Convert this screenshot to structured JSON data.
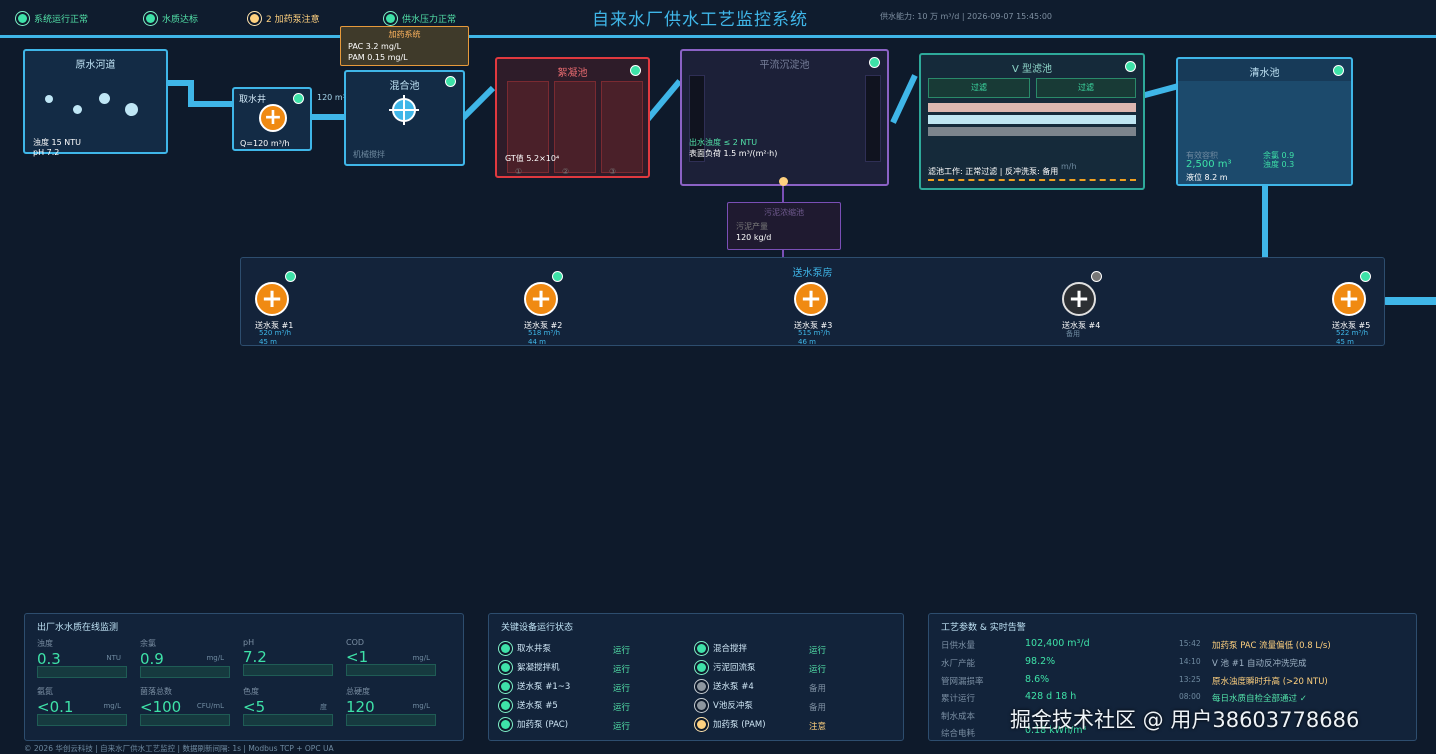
{
  "header": {
    "title": "自来水厂供水工艺监控系统",
    "capacity": "供水能力: 10 万 m³/d  |  2026-09-07 15:45:00",
    "statuses": [
      {
        "label": "系统运行正常",
        "color": "#52e0a8"
      },
      {
        "label": "水质达标",
        "color": "#52e0a8"
      },
      {
        "label": "2 加药泵注意",
        "color": "#ffd17f"
      },
      {
        "label": "供水压力正常",
        "color": "#52e0a8"
      }
    ]
  },
  "colors": {
    "accent": "#3fb6e8",
    "ok": "#3ee2a8",
    "warn": "#ffd17f",
    "pump": "#f08a12"
  },
  "process": {
    "river": {
      "title": "原水河道",
      "turbidity": "浊度 15 NTU",
      "ph": "pH 7.2"
    },
    "intake": {
      "title": "取水井",
      "flow": "Q=120 m³/h",
      "pipe_label": "120 m³"
    },
    "dosing": {
      "title": "加药系统",
      "pac": "PAC  3.2 mg/L",
      "pam": "PAM  0.15 mg/L"
    },
    "mixing": {
      "title": "混合池",
      "sub": "机械搅拌"
    },
    "flocc": {
      "title": "絮凝池",
      "gt": "GT值 5.2×10⁴",
      "cells": [
        "①",
        "②",
        "③"
      ]
    },
    "sedim": {
      "title": "平流沉淀池",
      "out": "出水浊度 ≤ 2 NTU",
      "load": "表面负荷 1.5 m³/(m²·h)"
    },
    "sludge": {
      "title": "污泥浓缩池",
      "label": "污泥产量",
      "value": "120 kg/d"
    },
    "vfilter": {
      "title": "V 型滤池",
      "left": "过滤",
      "right": "过滤",
      "rate": "m/h",
      "status": "滤池工作: 正常过滤  |  反冲洗泵: 备用"
    },
    "clear": {
      "title": "清水池",
      "cap_label": "有效容积",
      "cap": "2,500 m³",
      "level": "液位 8.2 m",
      "chlorine": "余氯 0.9",
      "turb": "浊度 0.3"
    },
    "pumphouse": {
      "title": "送水泵房",
      "pumps": [
        {
          "name": "送水泵 #1",
          "flow": "520 m³/h",
          "head": "45 m",
          "on": true
        },
        {
          "name": "送水泵 #2",
          "flow": "518 m³/h",
          "head": "44 m",
          "on": true
        },
        {
          "name": "送水泵 #3",
          "flow": "515 m³/h",
          "head": "46 m",
          "on": true
        },
        {
          "name": "送水泵 #4",
          "flow": "备用",
          "head": "",
          "on": false
        },
        {
          "name": "送水泵 #5",
          "flow": "522 m³/h",
          "head": "45 m",
          "on": true
        }
      ]
    }
  },
  "quality": {
    "title": "出厂水水质在线监测",
    "metrics": [
      {
        "label": "浊度",
        "value": "0.3",
        "unit": "NTU"
      },
      {
        "label": "余氯",
        "value": "0.9",
        "unit": "mg/L"
      },
      {
        "label": "pH",
        "value": "7.2",
        "unit": ""
      },
      {
        "label": "COD",
        "value": "<1",
        "unit": "mg/L"
      },
      {
        "label": "氨氮",
        "value": "<0.1",
        "unit": "mg/L"
      },
      {
        "label": "菌落总数",
        "value": "<100",
        "unit": "CFU/mL"
      },
      {
        "label": "色度",
        "value": "<5",
        "unit": "度"
      },
      {
        "label": "总硬度",
        "value": "120",
        "unit": "mg/L"
      }
    ]
  },
  "equipment": {
    "title": "关键设备运行状态",
    "items": [
      {
        "name": "取水井泵",
        "state": "运行",
        "st": "g"
      },
      {
        "name": "混合搅拌",
        "state": "运行",
        "st": "g"
      },
      {
        "name": "絮凝搅拌机",
        "state": "运行",
        "st": "g"
      },
      {
        "name": "污泥回流泵",
        "state": "运行",
        "st": "g"
      },
      {
        "name": "送水泵 #1~3",
        "state": "运行",
        "st": "g"
      },
      {
        "name": "送水泵 #4",
        "state": "备用",
        "st": "gr"
      },
      {
        "name": "送水泵 #5",
        "state": "运行",
        "st": "g"
      },
      {
        "name": "V池反冲泵",
        "state": "备用",
        "st": "gr"
      },
      {
        "name": "加药泵 (PAC)",
        "state": "运行",
        "st": "g"
      },
      {
        "name": "加药泵 (PAM)",
        "state": "注意",
        "st": "y"
      }
    ]
  },
  "params": {
    "title": "工艺参数 & 实时告警",
    "rows": [
      {
        "k": "日供水量",
        "v": "102,400 m³/d"
      },
      {
        "k": "水厂产能",
        "v": "98.2%"
      },
      {
        "k": "管网漏损率",
        "v": "8.6%"
      },
      {
        "k": "累计运行",
        "v": "428 d 18 h"
      },
      {
        "k": "制水成本",
        "v": ""
      },
      {
        "k": "综合电耗",
        "v": "0.18 kWh/m³"
      }
    ],
    "alerts": [
      {
        "t": "15:42",
        "m": "加药泵 PAC 流量偏低 (0.8 L/s)",
        "c": "#ffd17f"
      },
      {
        "t": "14:10",
        "m": "V 池 #1 自动反冲洗完成",
        "c": "#9fb3c5"
      },
      {
        "t": "13:25",
        "m": "原水浊度瞬时升高 (>20 NTU)",
        "c": "#ffd17f"
      },
      {
        "t": "08:00",
        "m": "每日水质自检全部通过 ✓",
        "c": "#52e0a8"
      }
    ]
  },
  "footer": "© 2026 华创云科技  |  自来水厂供水工艺监控  |  数据刷新间隔: 1s  |  Modbus TCP + OPC UA",
  "watermark": "掘金技术社区 @ 用户38603778686"
}
